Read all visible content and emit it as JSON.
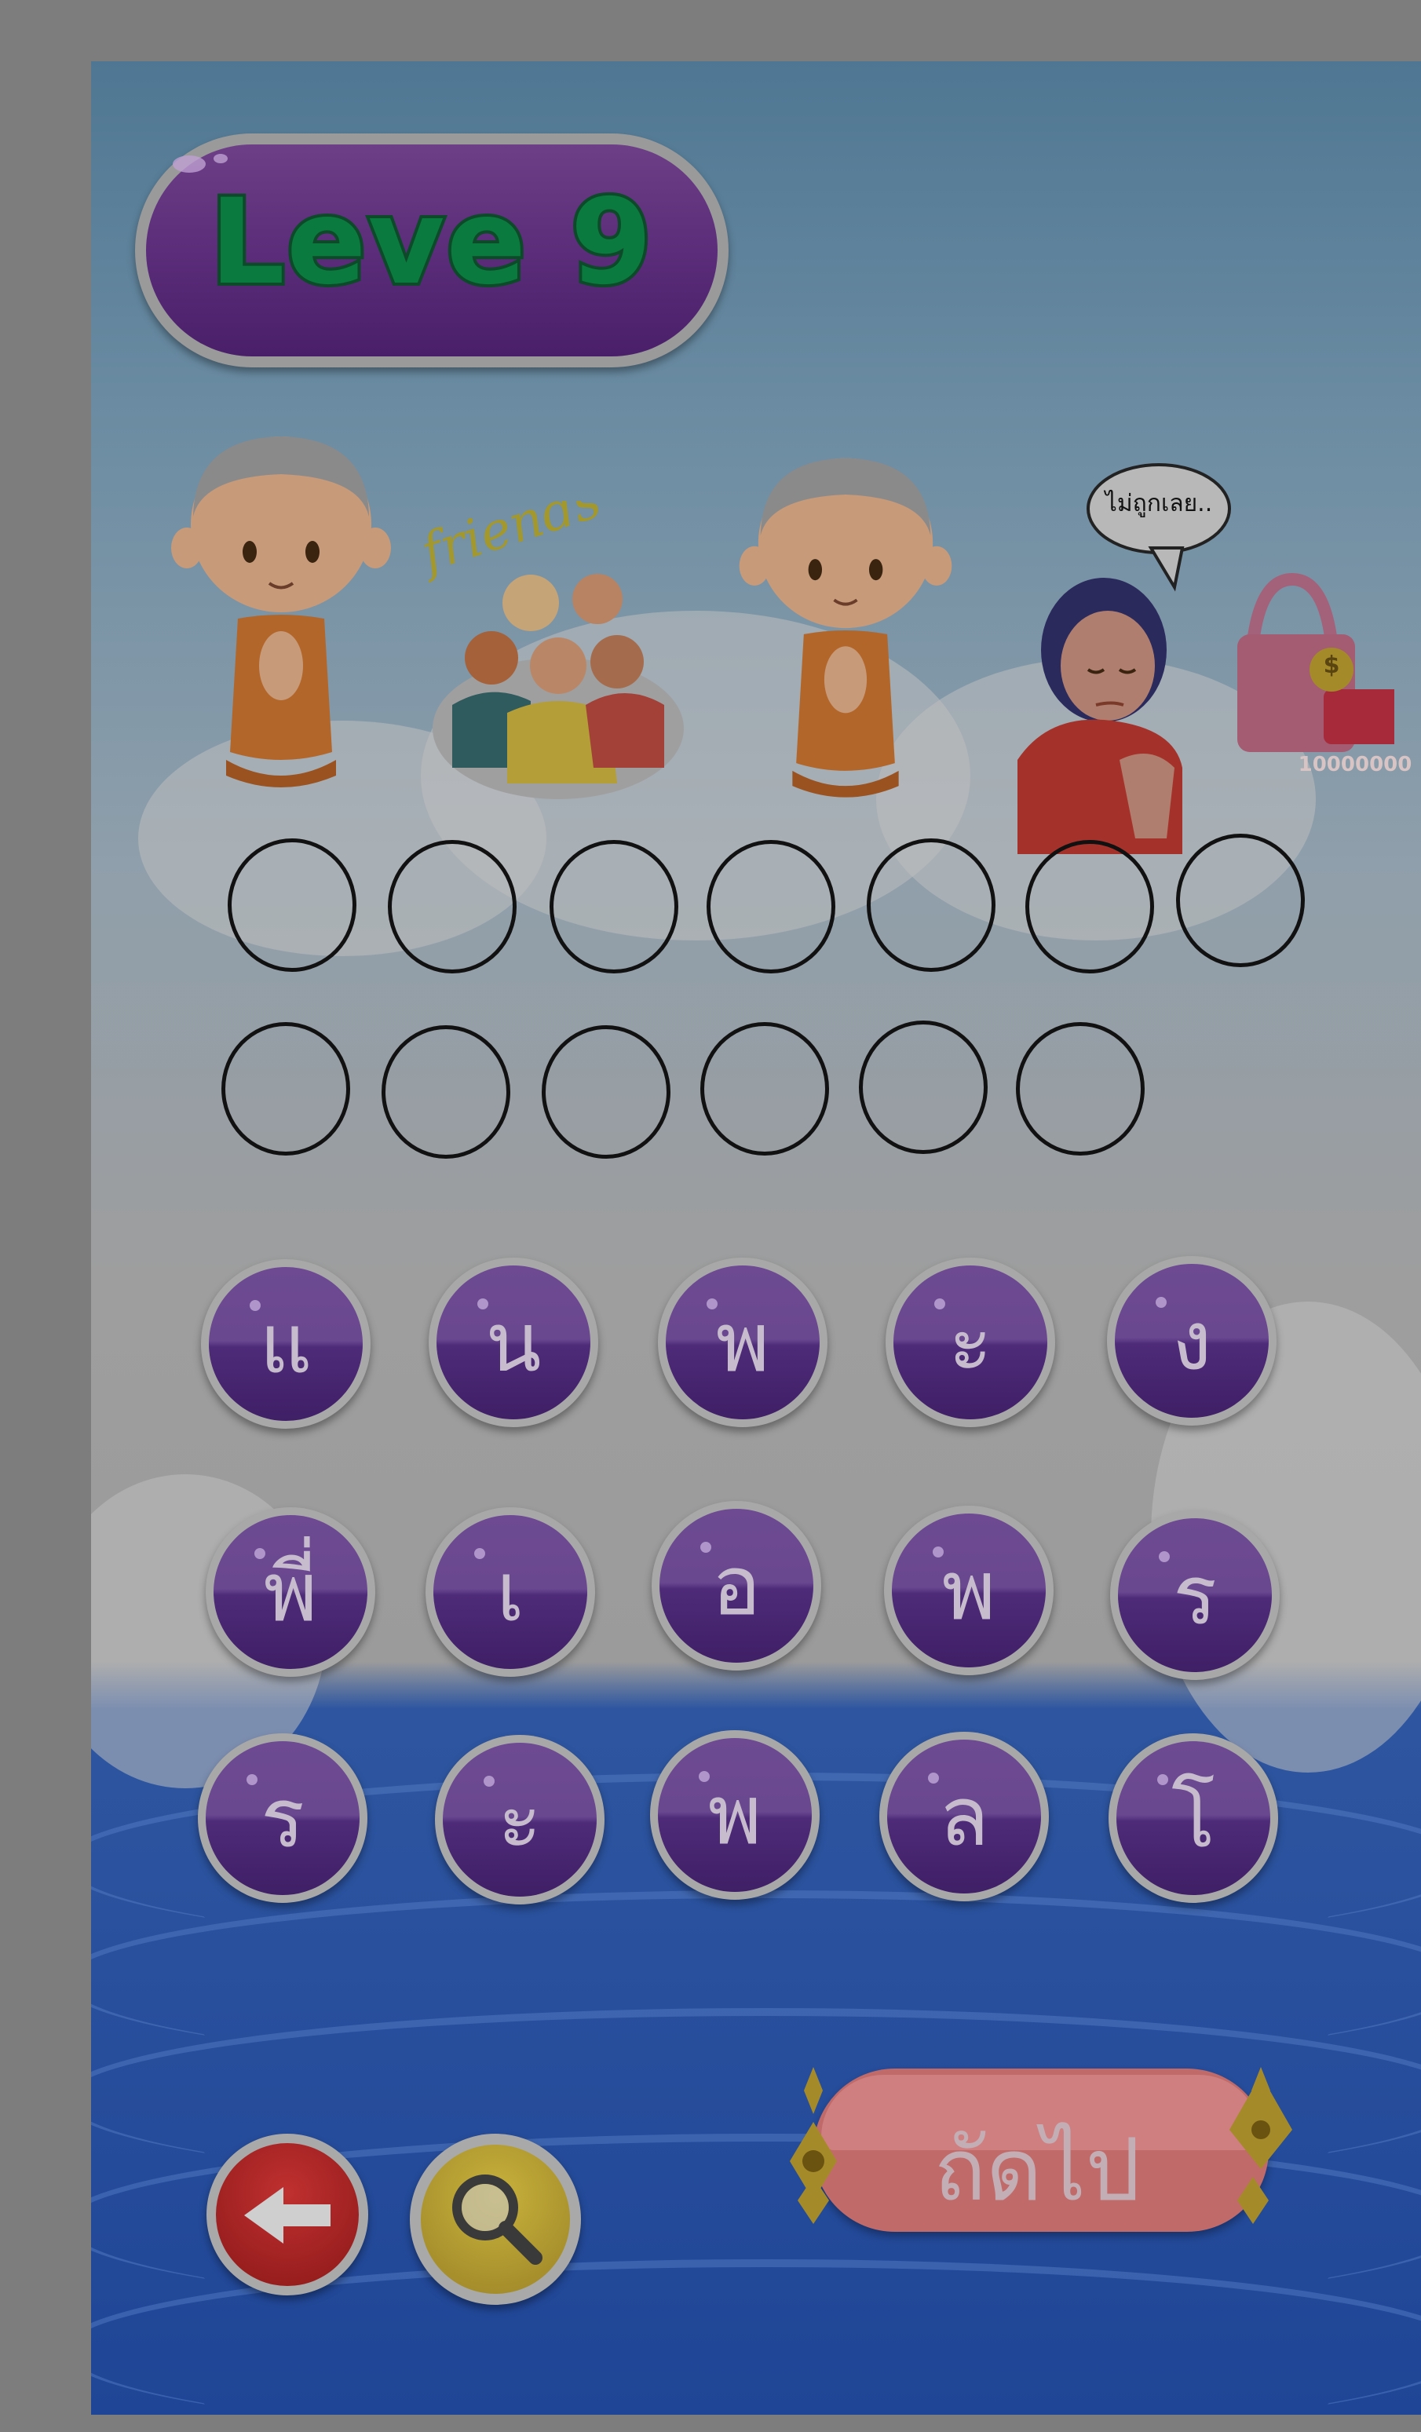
{
  "level": {
    "title": "Leve 9"
  },
  "clues": [
    {
      "name": "monk-1",
      "caption": ""
    },
    {
      "name": "friends",
      "caption": "friends"
    },
    {
      "name": "monk-2",
      "caption": ""
    },
    {
      "name": "woman-price",
      "speech": "ไม่ถูกเลย..",
      "price": "10000000",
      "coin": "$"
    }
  ],
  "answer": {
    "row1_slots": 7,
    "row2_slots": 6
  },
  "letters": [
    [
      "แ",
      "น",
      "พ",
      "ะ",
      "ง"
    ],
    [
      "พี่",
      "เ",
      "อ",
      "พ",
      "ร"
    ],
    [
      "ร",
      "ะ",
      "พ",
      "ล",
      "โ"
    ]
  ],
  "controls": {
    "next_label": "ถัดไป",
    "back_icon": "arrow-left-icon",
    "hint_icon": "magnifier-icon"
  },
  "colors": {
    "tile": "#5a3680",
    "title_text": "#0a7a3e",
    "next": "#c06a6a",
    "back": "#a82222",
    "hint": "#b59b30"
  }
}
